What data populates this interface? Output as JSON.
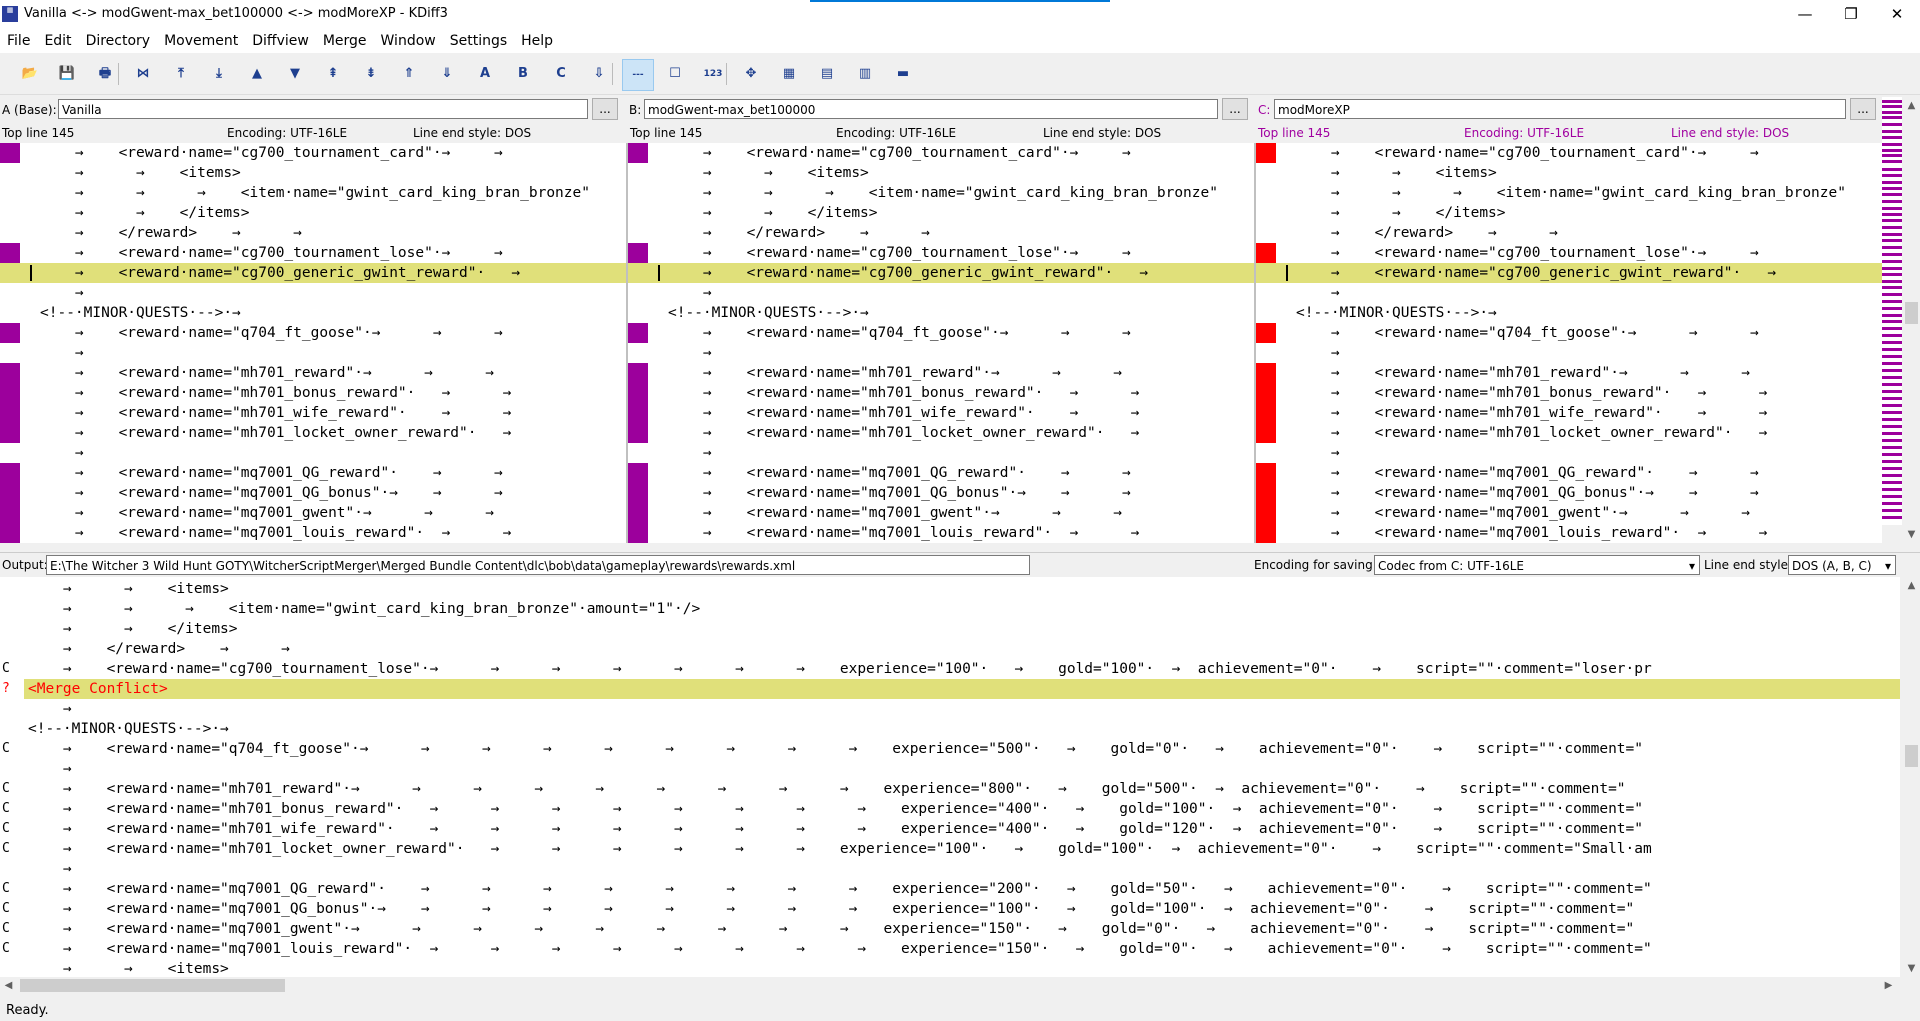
{
  "window": {
    "title": "Vanilla <-> modGwent-max_bet100000 <-> modMoreXP - KDiff3",
    "minimize": "—",
    "maximize": "❐",
    "close": "✕"
  },
  "menu": [
    "File",
    "Edit",
    "Directory",
    "Movement",
    "Diffview",
    "Merge",
    "Window",
    "Settings",
    "Help"
  ],
  "toolbar": [
    {
      "name": "open-icon",
      "glyph": "📂"
    },
    {
      "name": "save-icon",
      "glyph": "💾"
    },
    {
      "name": "print-icon",
      "glyph": "🖶"
    },
    {
      "name": "goto-current-delta-icon",
      "glyph": "⋈"
    },
    {
      "name": "goto-first-delta-icon",
      "glyph": "⤒"
    },
    {
      "name": "goto-last-delta-icon",
      "glyph": "⤓"
    },
    {
      "name": "goto-prev-delta-icon",
      "glyph": "▲"
    },
    {
      "name": "goto-next-delta-icon",
      "glyph": "▼"
    },
    {
      "name": "goto-prev-conflict-icon",
      "glyph": "⇞"
    },
    {
      "name": "goto-next-conflict-icon",
      "glyph": "⇟"
    },
    {
      "name": "goto-prev-unsolved-conflict-icon",
      "glyph": "⇑"
    },
    {
      "name": "goto-next-unsolved-conflict-icon",
      "glyph": "⇓"
    },
    {
      "name": "select-a-icon",
      "glyph": "A"
    },
    {
      "name": "select-b-icon",
      "glyph": "B"
    },
    {
      "name": "select-c-icon",
      "glyph": "C"
    },
    {
      "name": "auto-advance-icon",
      "glyph": "⇩"
    },
    {
      "name": "show-whitespace-chars-icon",
      "glyph": "---"
    },
    {
      "name": "show-whitespace-icon",
      "glyph": "☐"
    },
    {
      "name": "show-line-numbers-icon",
      "glyph": "123"
    },
    {
      "name": "choose-all-icon",
      "glyph": "✥"
    },
    {
      "name": "window-split-icon",
      "glyph": "▦"
    },
    {
      "name": "window-arrange-icon",
      "glyph": "▤"
    },
    {
      "name": "window-toggle-icon",
      "glyph": "▥"
    },
    {
      "name": "overview-icon",
      "glyph": "▬"
    }
  ],
  "panes": {
    "a": {
      "label": "A (Base):",
      "file": "Vanilla",
      "top_line": "Top line 145",
      "encoding": "Encoding: UTF-16LE",
      "line_end": "Line end style: DOS",
      "color": "#000000"
    },
    "b": {
      "label": "B:",
      "file": "modGwent-max_bet100000",
      "top_line": "Top line 145",
      "encoding": "Encoding: UTF-16LE",
      "line_end": "Line end style: DOS",
      "color": "#000000"
    },
    "c": {
      "label": "C:",
      "file": "modMoreXP",
      "top_line": "Top line 145",
      "encoding": "Encoding: UTF-16LE",
      "line_end": "Line end style: DOS",
      "color": "#a000a0"
    },
    "browse": "..."
  },
  "diff_lines": [
    "    →    <reward·name=\"cg700_tournament_card\"·→     →",
    "    →      →    <items>",
    "    →      →      →    <item·name=\"gwint_card_king_bran_bronze\"",
    "    →      →    </items>",
    "    →    </reward>    →      →",
    "    →    <reward·name=\"cg700_tournament_lose\"·→     →",
    "    →    <reward·name=\"cg700_generic_gwint_reward\"·   →",
    "    →",
    "<!--·MINOR·QUESTS·-->·→",
    "    →    <reward·name=\"q704_ft_goose\"·→      →      →",
    "    →",
    "    →    <reward·name=\"mh701_reward\"·→      →      →",
    "    →    <reward·name=\"mh701_bonus_reward\"·   →      →",
    "    →    <reward·name=\"mh701_wife_reward\"·    →      →",
    "    →    <reward·name=\"mh701_locket_owner_reward\"·   →",
    "    →",
    "    →    <reward·name=\"mq7001_QG_reward\"·    →      →",
    "    →    <reward·name=\"mq7001_QG_bonus\"·→    →      →",
    "    →    <reward·name=\"mq7001_gwent\"·→      →      →",
    "    →    <reward·name=\"mq7001_louis_reward\"·  →      →"
  ],
  "output": {
    "label": "Output:",
    "path": "E:\\The Witcher 3 Wild Hunt GOTY\\WitcherScriptMerger\\Merged Bundle Content\\dlc\\bob\\data\\gameplay\\rewards\\rewards.xml",
    "encoding_label": "Encoding for saving:",
    "encoding_value": "Codec from C: UTF-16LE",
    "line_end_label": "Line end style:",
    "line_end_value": "DOS (A, B, C)"
  },
  "merge_lines": [
    {
      "flag": "",
      "text": "    →      →    <items>"
    },
    {
      "flag": "",
      "text": "    →      →      →    <item·name=\"gwint_card_king_bran_bronze\"·amount=\"1\"·/>"
    },
    {
      "flag": "",
      "text": "    →      →    </items>"
    },
    {
      "flag": "",
      "text": "    →    </reward>    →      →"
    },
    {
      "flag": "C",
      "text": "    →    <reward·name=\"cg700_tournament_lose\"·→      →      →      →      →      →      →    experience=\"100\"·   →    gold=\"100\"·  →  achievement=\"0\"·    →    script=\"\"·comment=\"loser·pr"
    },
    {
      "flag": "?",
      "text": "<Merge Conflict>",
      "conflict": true
    },
    {
      "flag": "",
      "text": "    →"
    },
    {
      "flag": "",
      "text": "<!--·MINOR·QUESTS·-->·→"
    },
    {
      "flag": "C",
      "text": "    →    <reward·name=\"q704_ft_goose\"·→      →      →      →      →      →      →      →      →    experience=\"500\"·   →    gold=\"0\"·   →    achievement=\"0\"·    →    script=\"\"·comment=\""
    },
    {
      "flag": "",
      "text": "    →"
    },
    {
      "flag": "C",
      "text": "    →    <reward·name=\"mh701_reward\"·→      →      →      →      →      →      →      →      →    experience=\"800\"·   →    gold=\"500\"·  →  achievement=\"0\"·    →    script=\"\"·comment=\""
    },
    {
      "flag": "C",
      "text": "    →    <reward·name=\"mh701_bonus_reward\"·   →      →      →      →      →      →      →      →    experience=\"400\"·   →    gold=\"100\"·  →  achievement=\"0\"·    →    script=\"\"·comment=\""
    },
    {
      "flag": "C",
      "text": "    →    <reward·name=\"mh701_wife_reward\"·    →      →      →      →      →      →      →      →    experience=\"400\"·   →    gold=\"120\"·  →  achievement=\"0\"·    →    script=\"\"·comment=\""
    },
    {
      "flag": "C",
      "text": "    →    <reward·name=\"mh701_locket_owner_reward\"·   →      →      →      →      →      →    experience=\"100\"·   →    gold=\"100\"·  →  achievement=\"0\"·    →    script=\"\"·comment=\"Small·am"
    },
    {
      "flag": "",
      "text": "    →"
    },
    {
      "flag": "C",
      "text": "    →    <reward·name=\"mq7001_QG_reward\"·    →      →      →      →      →      →      →      →    experience=\"200\"·   →    gold=\"50\"·   →    achievement=\"0\"·    →    script=\"\"·comment=\""
    },
    {
      "flag": "C",
      "text": "    →    <reward·name=\"mq7001_QG_bonus\"·→    →      →      →      →      →      →      →      →    experience=\"100\"·   →    gold=\"100\"·  →  achievement=\"0\"·    →    script=\"\"·comment=\""
    },
    {
      "flag": "C",
      "text": "    →    <reward·name=\"mq7001_gwent\"·→      →      →      →      →      →      →      →      →    experience=\"150\"·   →    gold=\"0\"·   →    achievement=\"0\"·    →    script=\"\"·comment=\""
    },
    {
      "flag": "C",
      "text": "    →    <reward·name=\"mq7001_louis_reward\"·  →      →      →      →      →      →      →      →    experience=\"150\"·   →    gold=\"0\"·   →    achievement=\"0\"·    →    script=\"\"·comment=\""
    },
    {
      "flag": "",
      "text": "    →      →    <items>"
    }
  ],
  "status": "Ready.",
  "colors": {
    "a_marker": "#9c009c",
    "b_marker": "#9c009c",
    "c_marker": "#ff0000",
    "highlight": "#e0e07a",
    "conflict_text": "#ff0000"
  }
}
